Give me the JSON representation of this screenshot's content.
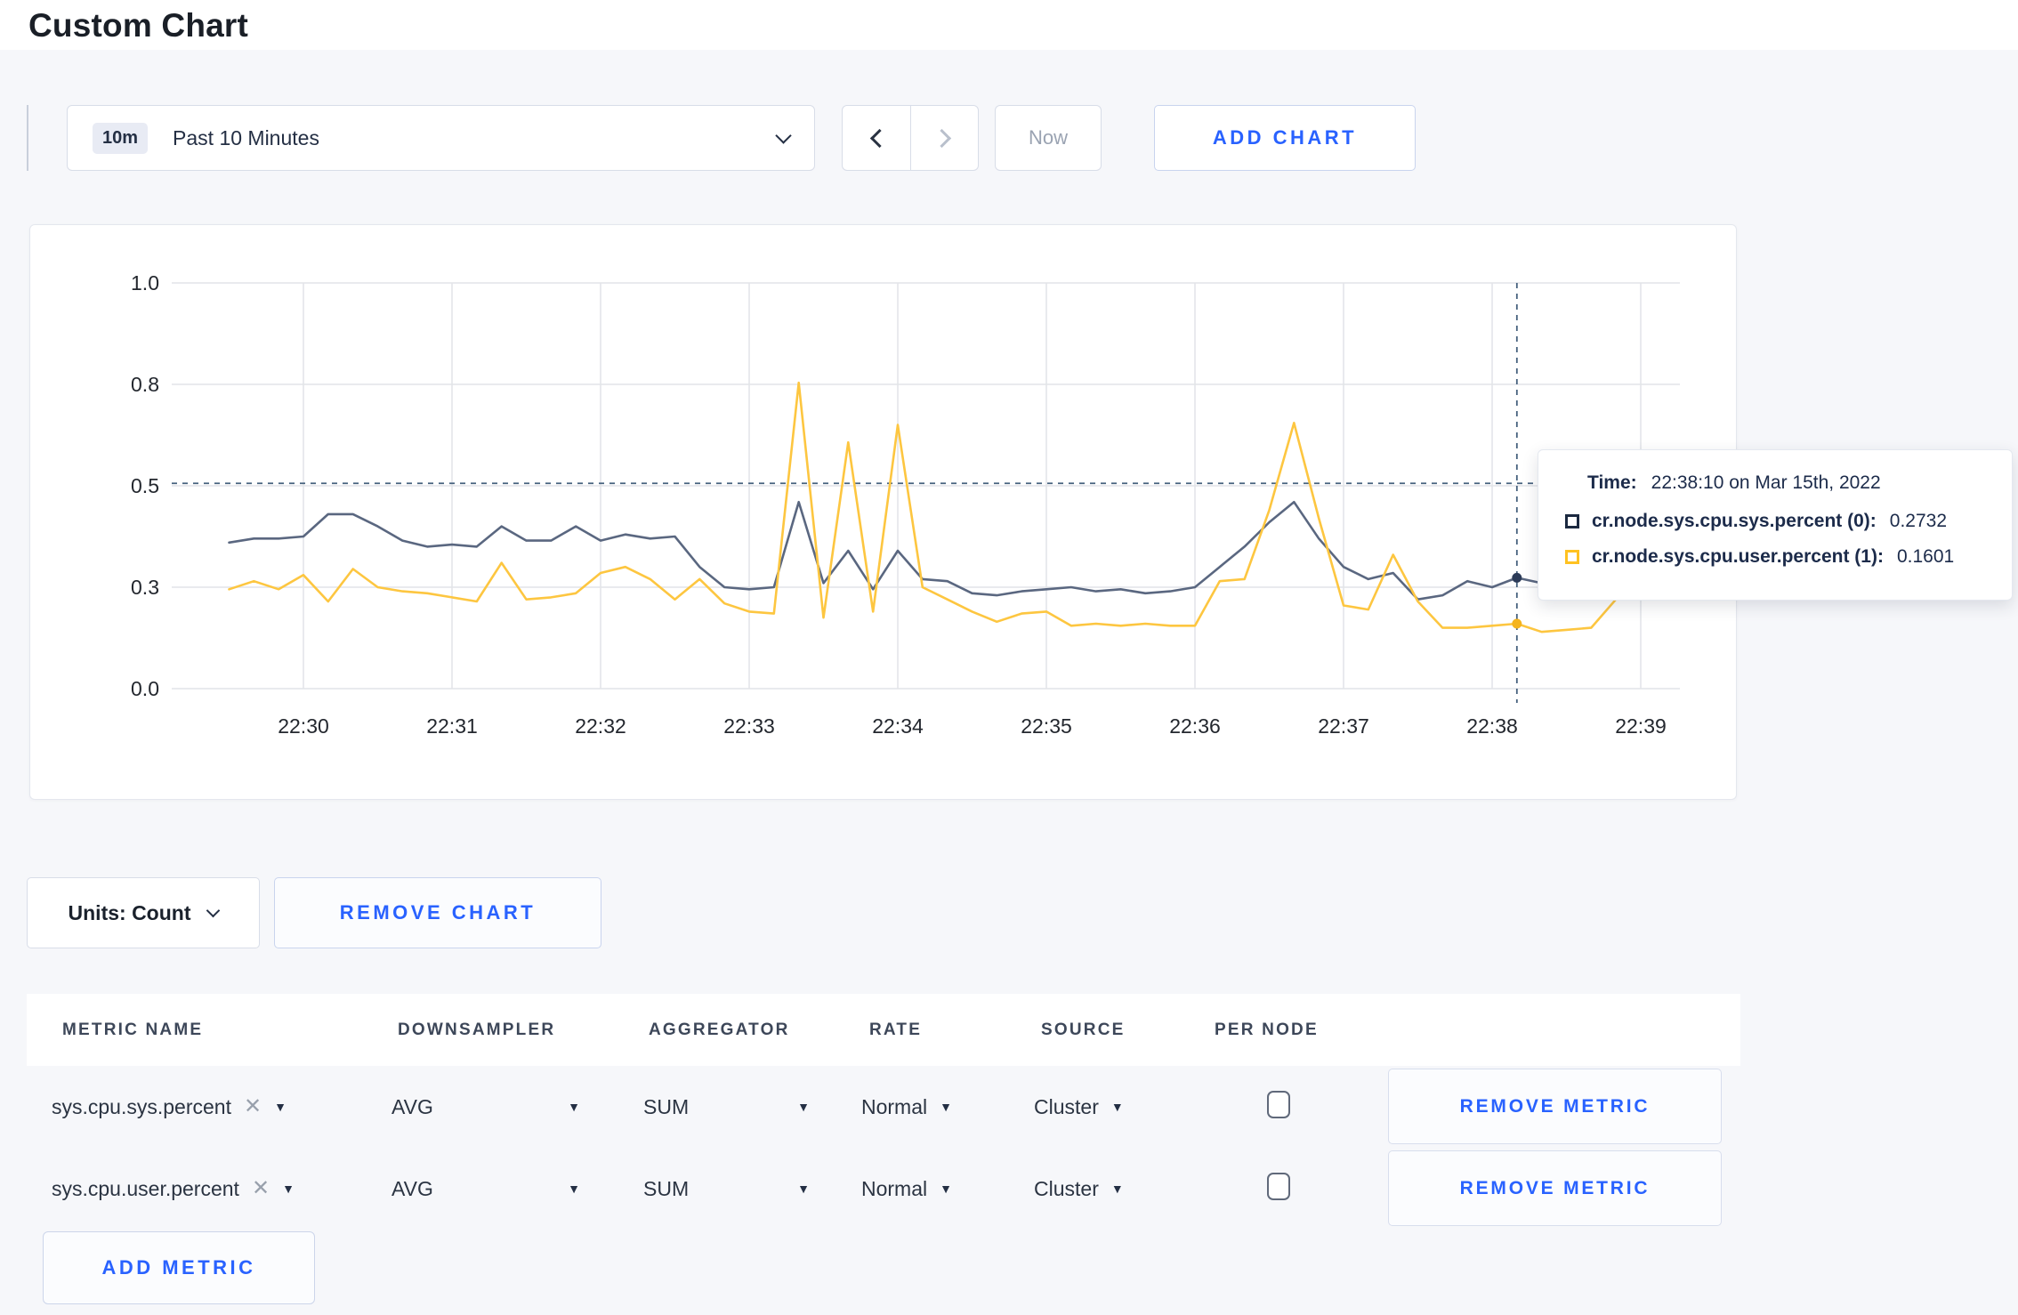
{
  "page": {
    "title": "Custom Chart"
  },
  "toolbar": {
    "range_badge": "10m",
    "range_label": "Past 10 Minutes",
    "now_label": "Now",
    "add_chart_label": "ADD CHART"
  },
  "chart_controls": {
    "units_label": "Units: Count",
    "remove_chart_label": "REMOVE CHART",
    "add_metric_label": "ADD METRIC"
  },
  "tooltip": {
    "time_label": "Time:",
    "time_value": "22:38:10 on Mar 15th, 2022",
    "series": [
      {
        "label": "cr.node.sys.cpu.sys.percent (0):",
        "value": "0.2732",
        "color": "#1b2940"
      },
      {
        "label": "cr.node.sys.cpu.user.percent (1):",
        "value": "0.1601",
        "color": "#ffc221"
      }
    ]
  },
  "table": {
    "headers": [
      "METRIC NAME",
      "DOWNSAMPLER",
      "AGGREGATOR",
      "RATE",
      "SOURCE",
      "PER NODE"
    ],
    "rows": [
      {
        "metric": "sys.cpu.sys.percent",
        "downsampler": "AVG",
        "aggregator": "SUM",
        "rate": "Normal",
        "source": "Cluster",
        "per_node_checked": false,
        "remove_label": "REMOVE METRIC"
      },
      {
        "metric": "sys.cpu.user.percent",
        "downsampler": "AVG",
        "aggregator": "SUM",
        "rate": "Normal",
        "source": "Cluster",
        "per_node_checked": false,
        "remove_label": "REMOVE METRIC"
      }
    ]
  },
  "chart_data": {
    "type": "line",
    "title": "",
    "xlabel": "",
    "ylabel": "",
    "ylim": [
      0,
      1
    ],
    "grid": true,
    "x_start": "22:29:30",
    "x_end": "22:39:10",
    "x_interval_seconds": 10,
    "x_tick_labels": [
      "22:30",
      "22:31",
      "22:32",
      "22:33",
      "22:34",
      "22:35",
      "22:36",
      "22:37",
      "22:38",
      "22:39"
    ],
    "y_ticks": [
      {
        "value": 0,
        "label": "0.0"
      },
      {
        "value": 0.25,
        "label": "0.3"
      },
      {
        "value": 0.5,
        "label": "0.5"
      },
      {
        "value": 0.75,
        "label": "0.8"
      },
      {
        "value": 1,
        "label": "1.0"
      }
    ],
    "series": [
      {
        "name": "cr.node.sys.cpu.sys.percent",
        "color": "#5a6780",
        "point_color": "#2c3b58",
        "values": [
          0.36,
          0.37,
          0.37,
          0.375,
          0.43,
          0.43,
          0.4,
          0.365,
          0.35,
          0.355,
          0.35,
          0.4,
          0.365,
          0.365,
          0.4,
          0.365,
          0.38,
          0.37,
          0.375,
          0.3,
          0.25,
          0.245,
          0.25,
          0.46,
          0.26,
          0.34,
          0.245,
          0.34,
          0.27,
          0.265,
          0.235,
          0.23,
          0.24,
          0.245,
          0.25,
          0.24,
          0.245,
          0.235,
          0.24,
          0.25,
          0.3,
          0.35,
          0.41,
          0.46,
          0.37,
          0.3,
          0.27,
          0.285,
          0.22,
          0.23,
          0.265,
          0.25,
          0.2732,
          0.26,
          0.26,
          0.255,
          0.26,
          0.265,
          0.26
        ]
      },
      {
        "name": "cr.node.sys.cpu.user.percent",
        "color": "#fdc640",
        "point_color": "#f5b41e",
        "values": [
          0.245,
          0.265,
          0.245,
          0.28,
          0.215,
          0.295,
          0.25,
          0.24,
          0.235,
          0.225,
          0.215,
          0.31,
          0.22,
          0.225,
          0.235,
          0.285,
          0.3,
          0.27,
          0.22,
          0.27,
          0.21,
          0.19,
          0.185,
          0.754,
          0.175,
          0.607,
          0.19,
          0.65,
          0.25,
          0.22,
          0.19,
          0.165,
          0.185,
          0.19,
          0.155,
          0.16,
          0.155,
          0.16,
          0.155,
          0.155,
          0.265,
          0.27,
          0.44,
          0.655,
          0.42,
          0.205,
          0.195,
          0.33,
          0.215,
          0.15,
          0.15,
          0.155,
          0.1601,
          0.14,
          0.145,
          0.15,
          0.22,
          0.3,
          0.25
        ]
      }
    ],
    "crosshair": {
      "index": 52,
      "time": "22:38:10",
      "hline_value": 0.506,
      "color": "#46617e"
    }
  }
}
